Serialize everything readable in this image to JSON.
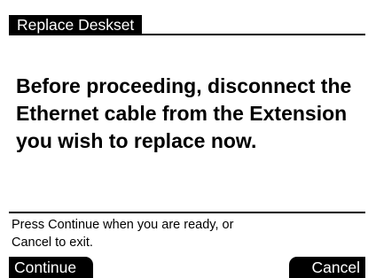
{
  "screen": {
    "title": "Replace Deskset",
    "message": "Before proceeding, disconnect the Ethernet cable from the Extension you wish to replace now.",
    "footer_line1": "Press Continue when you are ready, or",
    "footer_line2": "Cancel to exit."
  },
  "softkeys": {
    "left_label": "Continue",
    "right_label": "Cancel"
  },
  "colors": {
    "background": "#ffffff",
    "foreground": "#000000",
    "inverse_text": "#ffffff"
  }
}
